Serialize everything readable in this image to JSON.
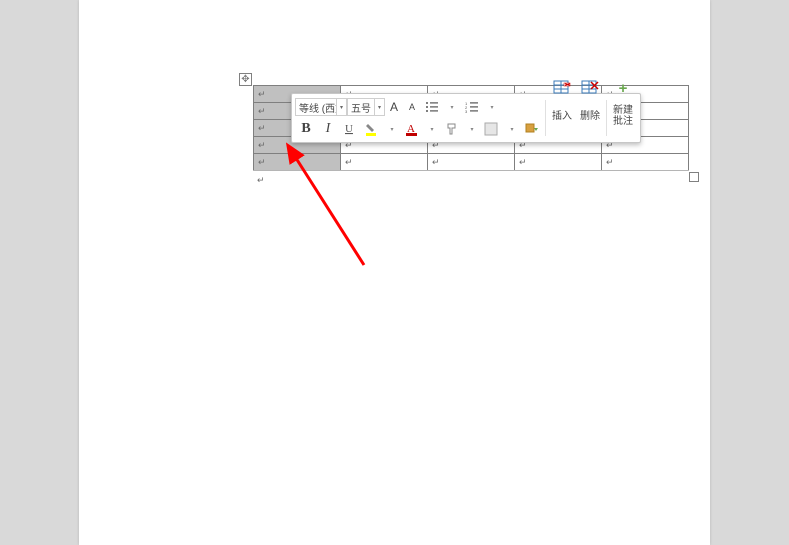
{
  "toolbar": {
    "font_name": "等线 (西文",
    "font_size": "五号",
    "grow_font": "A",
    "shrink_font": "A",
    "bold": "B",
    "italic": "I",
    "insert_label": "插入",
    "delete_label": "删除",
    "comment_label_line1": "新建",
    "comment_label_line2": "批注"
  },
  "table": {
    "rows": 5,
    "cols": 5,
    "selected_col_index": 0,
    "selected_row_from": 0,
    "selected_row_to": 4
  }
}
